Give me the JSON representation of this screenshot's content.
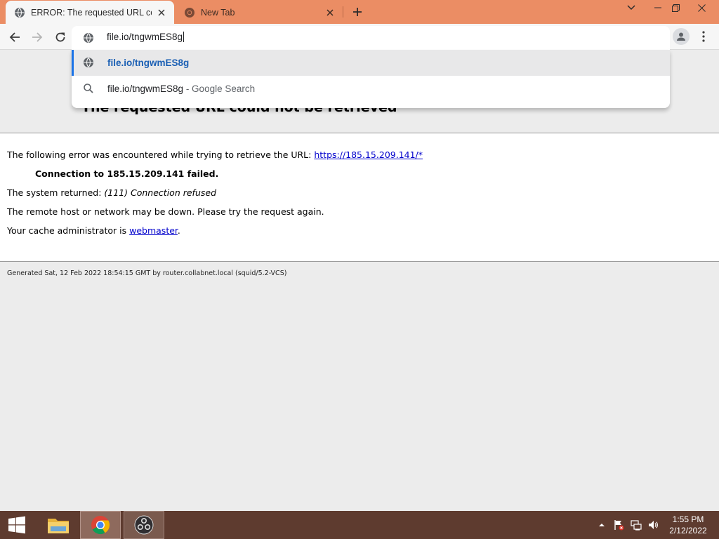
{
  "browser": {
    "tabs": [
      {
        "title": "ERROR: The requested URL could not be retrieved",
        "active": true
      },
      {
        "title": "New Tab",
        "active": false
      }
    ],
    "address_value": "file.io/tngwmES8g",
    "suggestions": [
      {
        "text": "file.io/tngwmES8g",
        "suffix": "",
        "kind": "url",
        "icon": "globe-icon"
      },
      {
        "text": "file.io/tngwmES8g",
        "suffix": " - Google Search",
        "kind": "search",
        "icon": "search-icon"
      }
    ]
  },
  "page": {
    "heading": "The requested URL could not be retrieved",
    "intro": "The following error was encountered while trying to retrieve the URL: ",
    "url_link": "https://185.15.209.141/*",
    "connection_failed": "Connection to 185.15.209.141 failed.",
    "system_returned_label": "The system returned: ",
    "system_returned_value": "(111) Connection refused",
    "remote_host_msg": "The remote host or network may be down. Please try the request again.",
    "cache_admin_prefix": "Your cache administrator is ",
    "cache_admin_link": "webmaster",
    "cache_admin_suffix": ".",
    "footer": "Generated Sat, 12 Feb 2022 18:54:15 GMT by router.collabnet.local (squid/5.2-VCS)"
  },
  "taskbar": {
    "items": [
      "windows-start",
      "file-explorer",
      "google-chrome",
      "obs-studio"
    ],
    "time": "1:55 PM",
    "date": "2/12/2022"
  },
  "colors": {
    "titlebar": "#eb8d64",
    "taskbar": "#5e3b2f",
    "link": "#0000cc",
    "accent": "#1a73e8"
  }
}
